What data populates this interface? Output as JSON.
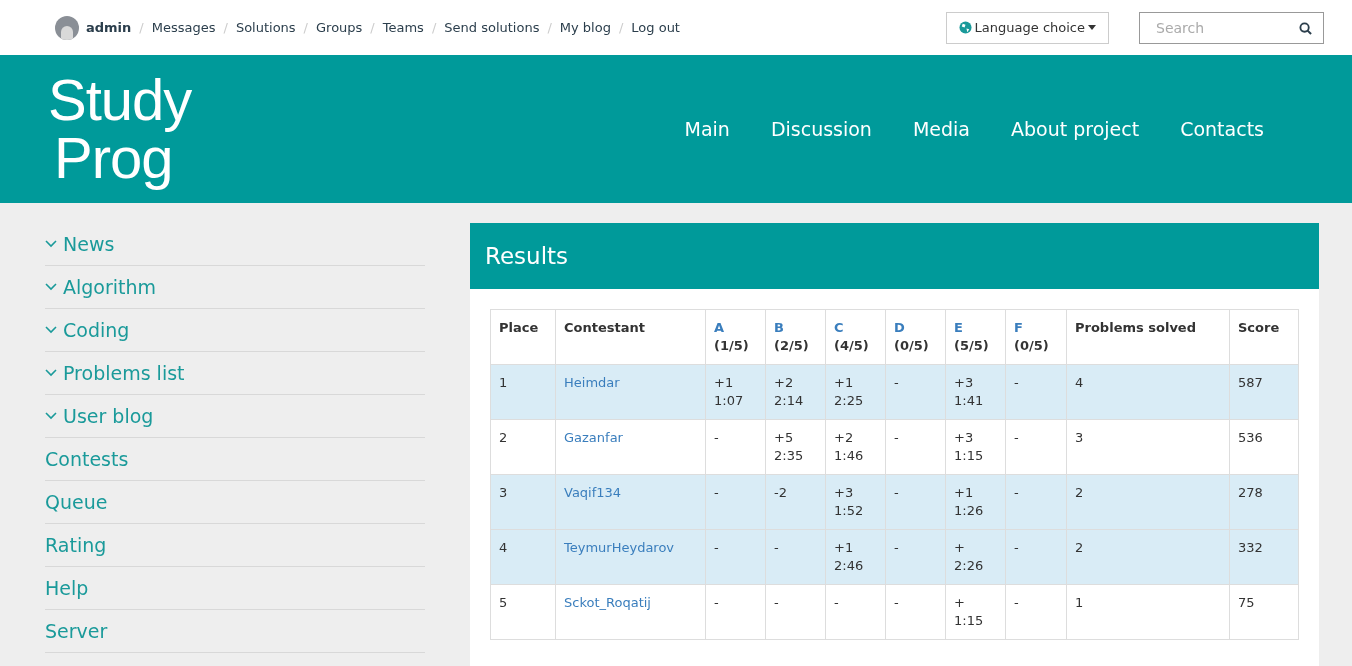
{
  "top_bar": {
    "user": "admin",
    "links": [
      {
        "separator": "/",
        "label": "Messages"
      },
      {
        "separator": "/",
        "label": "Solutions"
      },
      {
        "separator": "/",
        "label": "Groups"
      },
      {
        "separator": "/",
        "label": "Teams"
      },
      {
        "separator": "/",
        "label": "Send solutions"
      },
      {
        "separator": "/",
        "label": "My blog"
      },
      {
        "separator": "/",
        "label": "Log out"
      }
    ],
    "language_button": "Language choice",
    "search": {
      "placeholder": "Search"
    }
  },
  "header": {
    "logo": {
      "line1": "Study",
      "line2": "Prog"
    },
    "nav": [
      "Main",
      "Discussion",
      "Media",
      "About project",
      "Contacts"
    ]
  },
  "sidebar": {
    "items": [
      {
        "label": "News",
        "kind": "group"
      },
      {
        "label": "Algorithm",
        "kind": "group"
      },
      {
        "label": "Coding",
        "kind": "group"
      },
      {
        "label": "Problems list",
        "kind": "group"
      },
      {
        "label": "User blog",
        "kind": "group"
      },
      {
        "label": "Contests",
        "kind": "link"
      },
      {
        "label": "Queue",
        "kind": "link"
      },
      {
        "label": "Rating",
        "kind": "link"
      },
      {
        "label": "Help",
        "kind": "link"
      },
      {
        "label": "Server",
        "kind": "link"
      }
    ]
  },
  "results": {
    "title": "Results",
    "columns": [
      {
        "label": "Place",
        "kind": "plain"
      },
      {
        "label": "Contestant",
        "kind": "plain"
      },
      {
        "label": "A",
        "sub": "(1/5)",
        "kind": "problem"
      },
      {
        "label": "B",
        "sub": "(2/5)",
        "kind": "problem"
      },
      {
        "label": "C",
        "sub": "(4/5)",
        "kind": "problem"
      },
      {
        "label": "D",
        "sub": "(0/5)",
        "kind": "problem"
      },
      {
        "label": "E",
        "sub": "(5/5)",
        "kind": "problem"
      },
      {
        "label": "F",
        "sub": "(0/5)",
        "kind": "problem"
      },
      {
        "label": "Problems solved",
        "kind": "plain"
      },
      {
        "label": "Score",
        "kind": "plain"
      }
    ],
    "rows": [
      {
        "highlighted": true,
        "place": "1",
        "contestant": "Heimdar",
        "problems": [
          [
            "+1",
            "1:07"
          ],
          [
            "+2",
            "2:14"
          ],
          [
            "+1",
            "2:25"
          ],
          [
            "-"
          ],
          [
            "+3",
            "1:41"
          ],
          [
            "-"
          ]
        ],
        "solved": "4",
        "score": "587"
      },
      {
        "highlighted": false,
        "place": "2",
        "contestant": "Gazanfar",
        "problems": [
          [
            "-"
          ],
          [
            "+5",
            "2:35"
          ],
          [
            "+2",
            "1:46"
          ],
          [
            "-"
          ],
          [
            "+3",
            "1:15"
          ],
          [
            "-"
          ]
        ],
        "solved": "3",
        "score": "536"
      },
      {
        "highlighted": true,
        "place": "3",
        "contestant": "Vaqif134",
        "problems": [
          [
            "-"
          ],
          [
            "-2"
          ],
          [
            "+3",
            "1:52"
          ],
          [
            "-"
          ],
          [
            "+1",
            "1:26"
          ],
          [
            "-"
          ]
        ],
        "solved": "2",
        "score": "278"
      },
      {
        "highlighted": true,
        "place": "4",
        "contestant": "TeymurHeydarov",
        "problems": [
          [
            "-"
          ],
          [
            "-"
          ],
          [
            "+1",
            "2:46"
          ],
          [
            "-"
          ],
          [
            "+",
            "2:26"
          ],
          [
            "-"
          ]
        ],
        "solved": "2",
        "score": "332"
      },
      {
        "highlighted": false,
        "place": "5",
        "contestant": "Sckot_Roqatij",
        "problems": [
          [
            "-"
          ],
          [
            "-"
          ],
          [
            "-"
          ],
          [
            "-"
          ],
          [
            "+",
            "1:15"
          ],
          [
            "-"
          ]
        ],
        "solved": "1",
        "score": "75"
      }
    ]
  }
}
